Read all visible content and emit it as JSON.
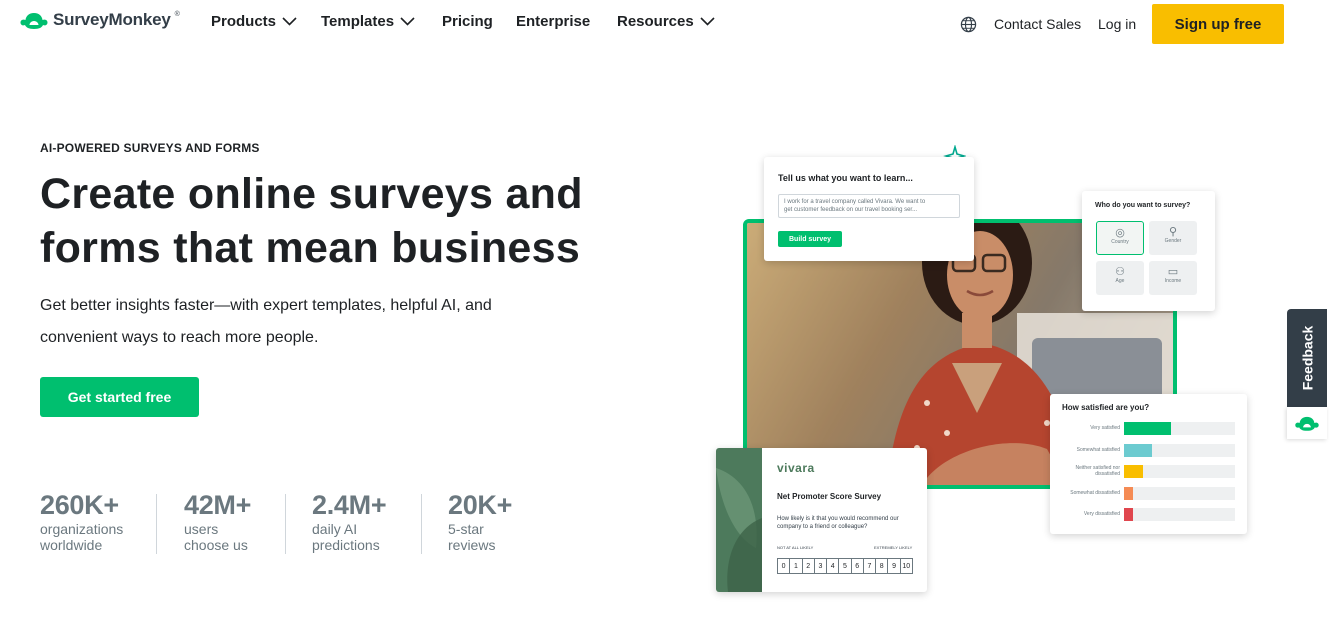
{
  "nav": {
    "logo_text": "SurveyMonkey",
    "logo_tm": "®",
    "items": [
      {
        "label": "Products"
      },
      {
        "label": "Templates"
      },
      {
        "label": "Pricing"
      },
      {
        "label": "Enterprise"
      },
      {
        "label": "Resources"
      }
    ],
    "contact_sales": "Contact Sales",
    "login": "Log in",
    "signup": "Sign up free"
  },
  "hero": {
    "eyebrow": "AI-POWERED SURVEYS AND FORMS",
    "headline_line1": "Create online surveys and",
    "headline_line2": "forms that mean business",
    "sub_line1": "Get better insights faster—with expert templates, helpful AI, and",
    "sub_line2": "convenient ways to reach more people.",
    "cta": "Get started free"
  },
  "stats": [
    {
      "value": "260K+",
      "line1": "organizations",
      "line2": "worldwide"
    },
    {
      "value": "42M+",
      "line1": "users",
      "line2": "choose us"
    },
    {
      "value": "2.4M+",
      "line1": "daily AI",
      "line2": "predictions"
    },
    {
      "value": "20K+",
      "line1": "5-star",
      "line2": "reviews"
    }
  ],
  "illustration": {
    "learn_card": {
      "title": "Tell us what you want to learn...",
      "input_text_line1": "I work for a travel company called Vivara. We want to",
      "input_text_line2": "get customer feedback on our travel booking ser...",
      "button": "Build survey"
    },
    "who_card": {
      "title": "Who do you want to survey?",
      "options": [
        "Country",
        "Gender",
        "Age",
        "Income"
      ]
    },
    "satisfied_card": {
      "title": "How satisfied are you?",
      "rows": [
        {
          "label": "Very satisfied",
          "value": 0.42,
          "color": "#00bf6f"
        },
        {
          "label": "Somewhat satisfied",
          "value": 0.25,
          "color": "#6ccbd0"
        },
        {
          "label": "Neither satisfied nor dissatisfied",
          "value": 0.17,
          "color": "#f9be00"
        },
        {
          "label": "Somewhat dissatisfied",
          "value": 0.08,
          "color": "#f58b54"
        },
        {
          "label": "Very dissatisfied",
          "value": 0.08,
          "color": "#e0464e"
        }
      ]
    },
    "nps_card": {
      "brand": "vivara",
      "title": "Net Promoter Score Survey",
      "question_line1": "How likely is it that you would recommend our",
      "question_line2": "company to a friend or colleague?",
      "low_label": "NOT AT ALL LIKELY",
      "high_label": "EXTREMELY LIKELY",
      "scale": [
        "0",
        "1",
        "2",
        "3",
        "4",
        "5",
        "6",
        "7",
        "8",
        "9",
        "10"
      ]
    }
  },
  "feedback_tab": "Feedback",
  "colors": {
    "brand_green": "#00bf6f",
    "signup_yellow": "#f9be00",
    "dark_slate": "#333e48",
    "stat_gray": "#6b787f"
  }
}
